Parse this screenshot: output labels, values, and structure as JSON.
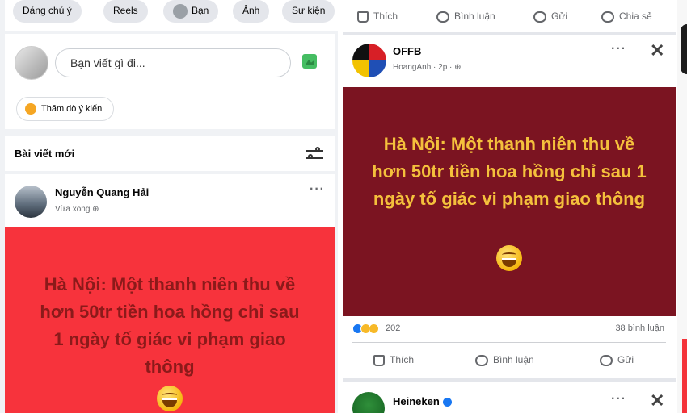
{
  "left": {
    "filters": [
      "Đáng chú ý",
      "Reels",
      "Bạn",
      "Ảnh",
      "Sự kiện"
    ],
    "composer": {
      "placeholder": "Bạn viết gì đi...",
      "poll": "Thăm dò ý kiến"
    },
    "section_title": "Bài viết mới",
    "post": {
      "author": "Nguyễn Quang Hải",
      "time": "Vừa xong",
      "text": "Hà Nội: Một thanh niên thu về hơn 50tr tiền hoa hồng chỉ sau 1 ngày tố giác vi phạm giao thông",
      "bg_color": "#f7333c",
      "text_color": "#8b1a1a"
    }
  },
  "right": {
    "top_actions": [
      "Thích",
      "Bình luận",
      "Gửi",
      "Chia sẻ"
    ],
    "post": {
      "author": "OFFB",
      "sub": "HoangAnh · 2p ·",
      "text": "Hà Nội: Một thanh niên thu về hơn 50tr tiền hoa hồng chỉ sau 1 ngày tố giác vi phạm giao thông",
      "bg_color": "#7b1421",
      "text_color": "#f4c03c",
      "reactions": "202",
      "comments": "38 bình luận",
      "actions": [
        "Thích",
        "Bình luận",
        "Gửi"
      ]
    },
    "next_post": {
      "author": "Heineken"
    }
  }
}
